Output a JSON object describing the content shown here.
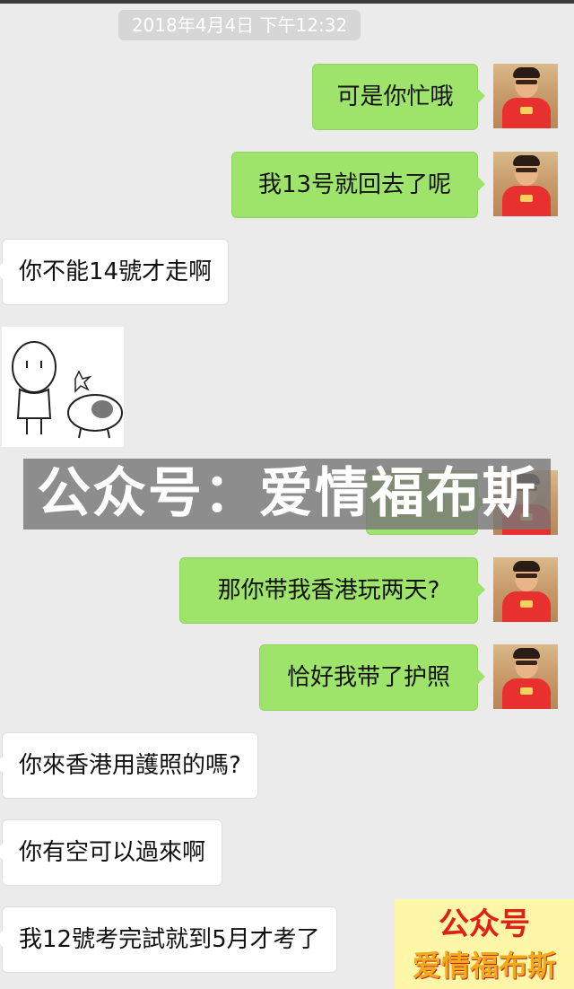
{
  "timestamp": "2018年4月4日 下午12:32",
  "messages": [
    {
      "text": "可是你忙哦"
    },
    {
      "text": "我13号就回去了呢"
    },
    {
      "text": "你不能14號才走啊"
    },
    {
      "text": "那你带我香港玩两天?"
    },
    {
      "text": "恰好我带了护照"
    },
    {
      "text": "你來香港用護照的嗎?"
    },
    {
      "text": "你有空可以過來啊"
    },
    {
      "text": "我12號考完試就到5月才考了"
    }
  ],
  "watermark": "公众号：爱情福布斯",
  "corner_logo": {
    "line1": "公众号",
    "line2": "爱情福布斯"
  },
  "colors": {
    "outgoing_bubble": "#9fe46a",
    "incoming_bubble": "#ffffff",
    "background": "#ebebeb"
  }
}
